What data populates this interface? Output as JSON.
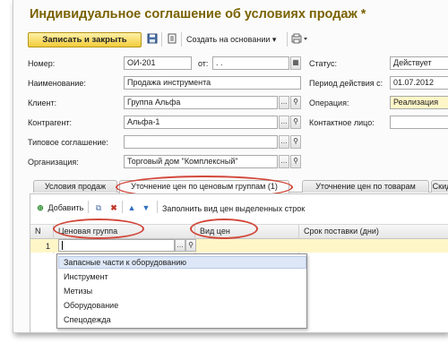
{
  "window": {
    "title": "Индивидуальное соглашение об условиях продаж *"
  },
  "toolbar": {
    "save_close_label": "Записать и закрыть",
    "create_based_label": "Создать на основании",
    "dropdown_glyph": "▾"
  },
  "form": {
    "number_label": "Номер:",
    "number_value": "ОИ-201",
    "from_label": "от:",
    "from_value": " .  .",
    "status_label": "Статус:",
    "status_value": "Действует",
    "name_label": "Наименование:",
    "name_value": "Продажа инструмента",
    "period_label": "Период действия с:",
    "period_value": "01.07.2012",
    "client_label": "Клиент:",
    "client_value": "Группа Альфа",
    "operation_label": "Операция:",
    "operation_value": "Реализация",
    "counterparty_label": "Контрагент:",
    "counterparty_value": "Альфа-1",
    "contact_label": "Контактное лицо:",
    "contact_value": "",
    "template_label": "Типовое соглашение:",
    "template_value": "",
    "org_label": "Организация:",
    "org_value": "Торговый дом \"Комплексный\""
  },
  "tabs": [
    {
      "label": "Условия продаж"
    },
    {
      "label": "Уточнение цен по ценовым группам (1)"
    },
    {
      "label": "Уточнение цен по товарам"
    },
    {
      "label": "Скид"
    }
  ],
  "table_toolbar": {
    "add_label": "Добавить",
    "fill_label": "Заполнить вид цен выделенных строк"
  },
  "table": {
    "columns": [
      "N",
      "Ценовая группа",
      "Вид цен",
      "Срок поставки (дни)"
    ],
    "rows": [
      {
        "n": "1",
        "price_group": "",
        "price_type": "",
        "delivery": ""
      }
    ]
  },
  "dropdown": {
    "items": [
      "Запасные части к оборудованию",
      "Инструмент",
      "Метизы",
      "Оборудование",
      "Спецодежда"
    ]
  },
  "colors": {
    "title": "#7a6200",
    "primary_button": "#f2cc3a",
    "highlight_ellipse": "#d2473a",
    "selection": "#dde7f7"
  }
}
